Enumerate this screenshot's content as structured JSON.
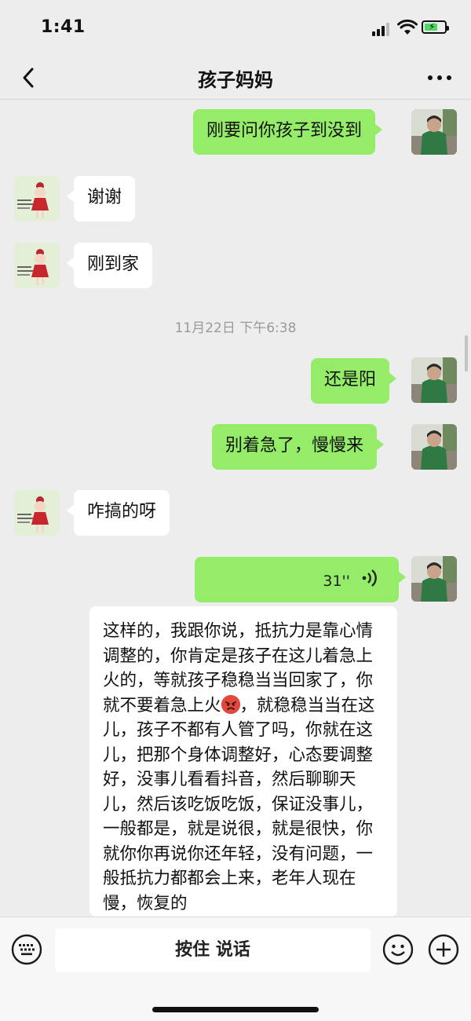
{
  "status_bar": {
    "time": "1:41"
  },
  "nav": {
    "title": "孩子妈妈"
  },
  "messages": {
    "m1": "刚要问你孩子到没到",
    "m2": "谢谢",
    "m3": "刚到家",
    "timestamp": "11月22日 下午6:38",
    "m4": "还是阳",
    "m5": "别着急了，慢慢来",
    "m6": "咋搞的呀",
    "voice_duration": "31''",
    "transcript_part1": "这样的，我跟你说，抵抗力是靠心情调整的，你肯定是孩子在这儿着急上火的，等就孩子稳稳当当回家了，你就不要着急上火",
    "transcript_part2": "，就稳稳当当在这儿，孩子不都有人管了吗，你就在这儿，把那个身体调整好，心态要调整好，没事儿看看抖音，然后聊聊天儿，然后该吃饭吃饭，保证没事儿，一般都是，就是说很，就是很快，你就你你再说你还年轻，没有问题，一般抵抗力都都会上来，老年人现在慢，恢复的"
  },
  "input_bar": {
    "talk_label": "按住 说话"
  },
  "icons": {
    "emoji_in_transcript": "angry-face-emoji"
  },
  "colors": {
    "sent_bubble": "#95ec69",
    "received_bubble": "#ffffff",
    "background": "#ededed"
  }
}
